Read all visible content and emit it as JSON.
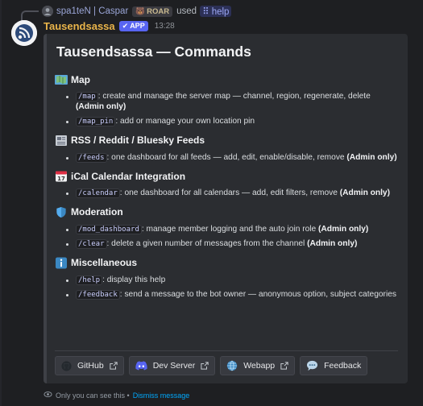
{
  "reply": {
    "user": "spa1teN | Caspar",
    "badge": "ROAR",
    "used": "used",
    "command": "help"
  },
  "header": {
    "bot_name": "Tausendsassa",
    "app_badge": "APP",
    "time": "13:28"
  },
  "embed": {
    "title": "Tausendsassa — Commands",
    "sections": [
      {
        "icon": "map-icon",
        "heading": "Map",
        "items": [
          {
            "cmd": "/map",
            "text": ": create and manage the server map — channel, region, regenerate, delete ",
            "bold": "(Admin only)"
          },
          {
            "cmd": "/map_pin",
            "text": ": add or manage your own location pin",
            "bold": ""
          }
        ]
      },
      {
        "icon": "newspaper-icon",
        "heading": "RSS / Reddit / Bluesky Feeds",
        "items": [
          {
            "cmd": "/feeds",
            "text": ": one dashboard for all feeds — add, edit, enable/disable, remove ",
            "bold": "(Admin only)"
          }
        ]
      },
      {
        "icon": "calendar-icon",
        "heading": "iCal Calendar Integration",
        "items": [
          {
            "cmd": "/calendar",
            "text": ": one dashboard for all calendars — add, edit filters, remove ",
            "bold": "(Admin only)"
          }
        ]
      },
      {
        "icon": "shield-icon",
        "heading": "Moderation",
        "items": [
          {
            "cmd": "/mod_dashboard",
            "text": ": manage member logging and the auto join role ",
            "bold": "(Admin only)"
          },
          {
            "cmd": "/clear",
            "text": ": delete a given number of messages from the channel ",
            "bold": "(Admin only)"
          }
        ]
      },
      {
        "icon": "info-icon",
        "heading": "Miscellaneous",
        "items": [
          {
            "cmd": "/help",
            "text": ": display this help",
            "bold": ""
          },
          {
            "cmd": "/feedback",
            "text": ": send a message to the bot owner — anonymous option, subject categories",
            "bold": ""
          }
        ]
      }
    ],
    "buttons": [
      {
        "label": "GitHub",
        "icon": "github-icon"
      },
      {
        "label": "Dev Server",
        "icon": "discord-icon"
      },
      {
        "label": "Webapp",
        "icon": "globe-icon"
      },
      {
        "label": "Feedback",
        "icon": "speech-bubble-icon"
      }
    ]
  },
  "footer": {
    "note": "Only you can see this •",
    "dismiss": "Dismiss message"
  },
  "colors": {
    "background": "#1e1f22",
    "embed": "#2b2d31",
    "bot_name": "#e9b44a",
    "accent": "#5865f2",
    "link": "#00a8fc"
  }
}
